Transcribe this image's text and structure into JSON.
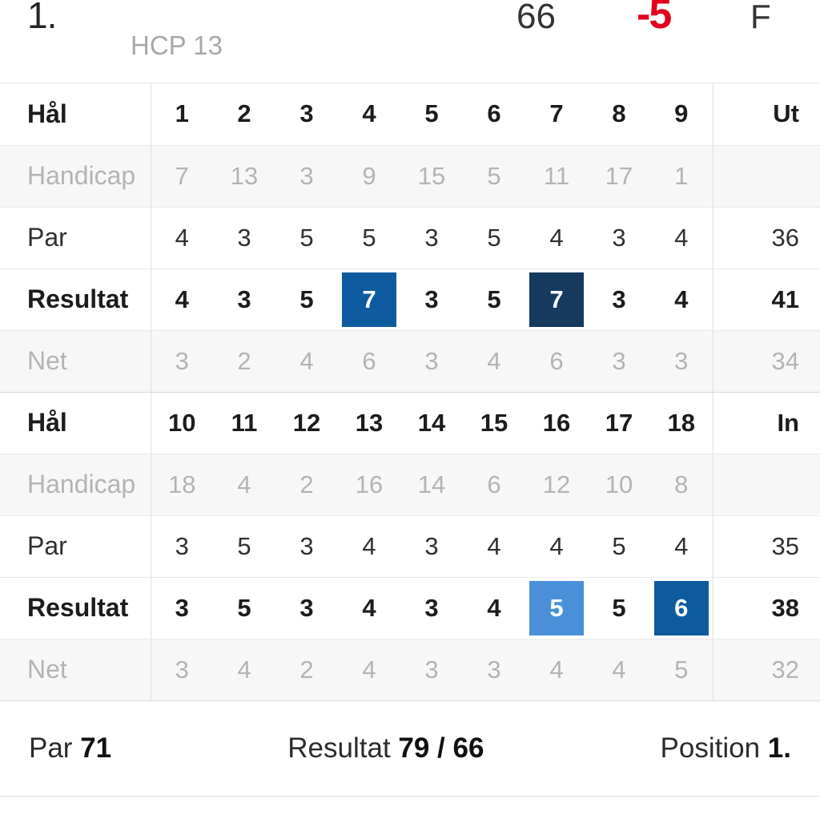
{
  "player_header": {
    "position": "1.",
    "hcp": "HCP 13",
    "score": "66",
    "to_par": "-5",
    "status": "F",
    "to_par_color": "#e4001b"
  },
  "scorecard": {
    "labels": {
      "hole": "Hål",
      "handicap": "Handicap",
      "par": "Par",
      "result": "Resultat",
      "net": "Net",
      "out": "Ut",
      "in": "In"
    },
    "front": {
      "holes": [
        "1",
        "2",
        "3",
        "4",
        "5",
        "6",
        "7",
        "8",
        "9"
      ],
      "handicap": [
        "7",
        "13",
        "3",
        "9",
        "15",
        "5",
        "11",
        "17",
        "1"
      ],
      "par": [
        "4",
        "3",
        "5",
        "5",
        "3",
        "5",
        "4",
        "3",
        "4"
      ],
      "result": [
        "4",
        "3",
        "5",
        "7",
        "3",
        "5",
        "7",
        "3",
        "4"
      ],
      "result_highlight": [
        "",
        "",
        "",
        "mid",
        "",
        "",
        "dark",
        "",
        ""
      ],
      "net": [
        "3",
        "2",
        "4",
        "6",
        "3",
        "4",
        "6",
        "3",
        "3"
      ],
      "total_hole": "Ut",
      "total_handicap": "",
      "total_par": "36",
      "total_result": "41",
      "total_net": "34"
    },
    "back": {
      "holes": [
        "10",
        "11",
        "12",
        "13",
        "14",
        "15",
        "16",
        "17",
        "18"
      ],
      "handicap": [
        "18",
        "4",
        "2",
        "16",
        "14",
        "6",
        "12",
        "10",
        "8"
      ],
      "par": [
        "3",
        "5",
        "3",
        "4",
        "3",
        "4",
        "4",
        "5",
        "4"
      ],
      "result": [
        "3",
        "5",
        "3",
        "4",
        "3",
        "4",
        "5",
        "5",
        "6"
      ],
      "result_highlight": [
        "",
        "",
        "",
        "",
        "",
        "",
        "light",
        "",
        "mid"
      ],
      "net": [
        "3",
        "4",
        "2",
        "4",
        "3",
        "3",
        "4",
        "4",
        "5"
      ],
      "total_hole": "In",
      "total_handicap": "",
      "total_par": "35",
      "total_result": "38",
      "total_net": "32"
    },
    "highlight_colors": {
      "dark": "#16395e",
      "mid": "#0d5b9e",
      "light": "#4a90d9"
    }
  },
  "summary": {
    "par_label": "Par",
    "par_value": "71",
    "result_label": "Resultat",
    "result_value": "79 / 66",
    "position_label": "Position",
    "position_value": "1."
  }
}
